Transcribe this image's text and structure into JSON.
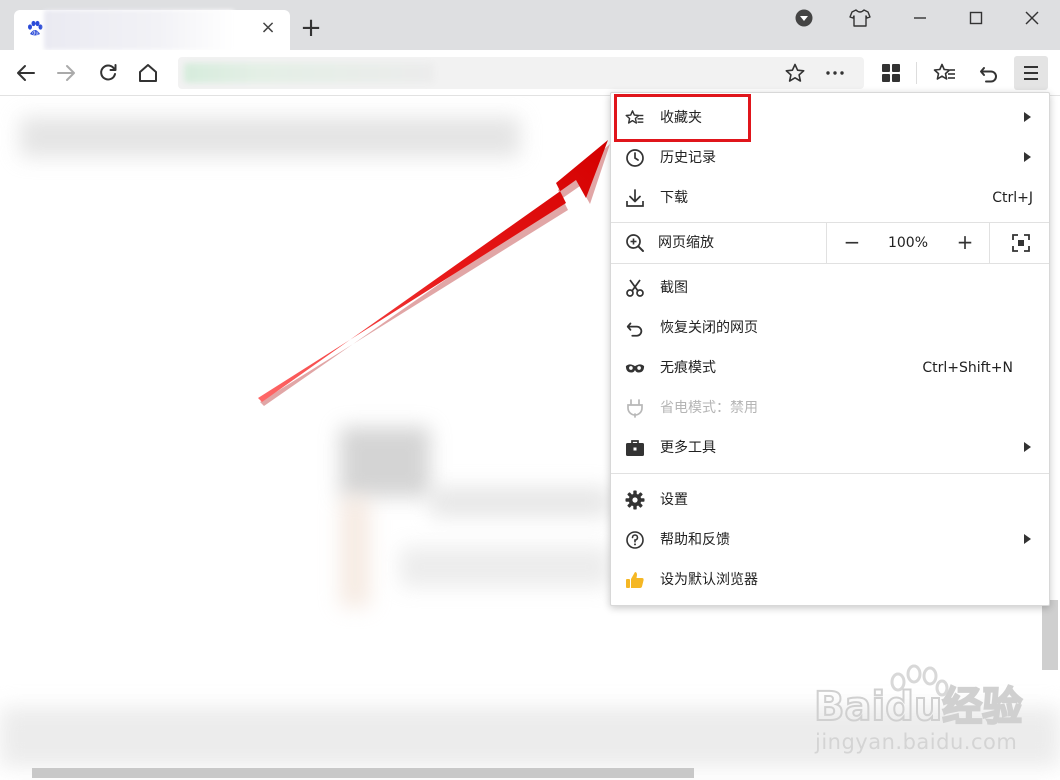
{
  "tabs": [
    {
      "close_glyph": "×"
    }
  ],
  "new_tab_glyph": "+",
  "toolbar_icons": [
    "back-icon",
    "forward-icon",
    "reload-icon",
    "home-icon",
    "star-icon",
    "more-icon",
    "apps-icon",
    "favorites-icon",
    "undo-icon",
    "menu-icon"
  ],
  "menu": {
    "favorites": "收藏夹",
    "history": "历史记录",
    "download": "下载",
    "download_shortcut": "Ctrl+J",
    "zoom_label": "网页缩放",
    "zoom_minus": "−",
    "zoom_value": "100%",
    "zoom_plus": "+",
    "screenshot": "截图",
    "restore_closed": "恢复关闭的网页",
    "incognito": "无痕模式",
    "incognito_shortcut": "Ctrl+Shift+N",
    "power_saving": "省电模式：禁用",
    "more_tools": "更多工具",
    "settings": "设置",
    "help_feedback": "帮助和反馈",
    "set_default": "设为默认浏览器"
  },
  "watermark": {
    "brand": "Baidu经验",
    "url": "jingyan.baidu.com"
  },
  "colors": {
    "highlight": "#e0151b",
    "tabstrip": "#dedfe1",
    "thumb": "#f5b724"
  }
}
